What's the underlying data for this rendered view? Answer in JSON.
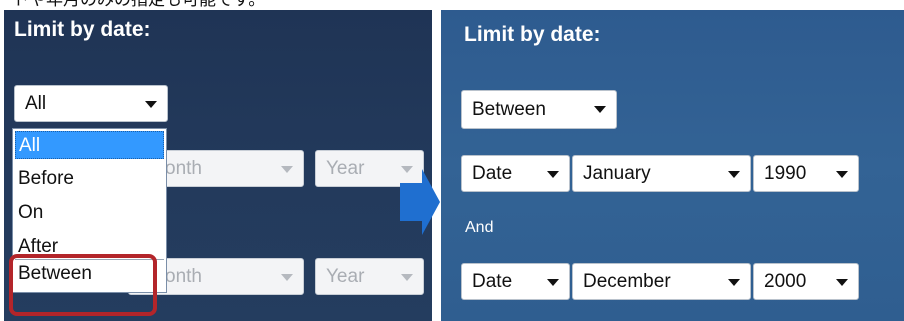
{
  "caption_cut": "トや年月のみの指定も可能です。",
  "left_panel": {
    "heading": "Limit by date:",
    "mode_select": {
      "value": "All"
    },
    "dropdown_options": [
      "All",
      "Before",
      "On",
      "After",
      "Between"
    ],
    "selected_option_index": 0,
    "row1": {
      "month_text": "onth",
      "year_text": "Year"
    },
    "row2": {
      "month_text": "onth",
      "year_text": "Year"
    }
  },
  "right_panel": {
    "heading": "Limit by date:",
    "mode_select": {
      "value": "Between"
    },
    "from": {
      "day": "Date",
      "month": "January",
      "year": "1990"
    },
    "and_label": "And",
    "to": {
      "day": "Date",
      "month": "December",
      "year": "2000"
    }
  },
  "colors": {
    "left_panel_bg": "#233a5c",
    "right_panel_bg": "#336395",
    "highlight_border": "#b3252a",
    "selected_option_bg": "#3399ff",
    "connector_arrow": "#1f6fd0"
  },
  "icons": [
    "chevron-down-icon",
    "right-arrow-icon"
  ]
}
